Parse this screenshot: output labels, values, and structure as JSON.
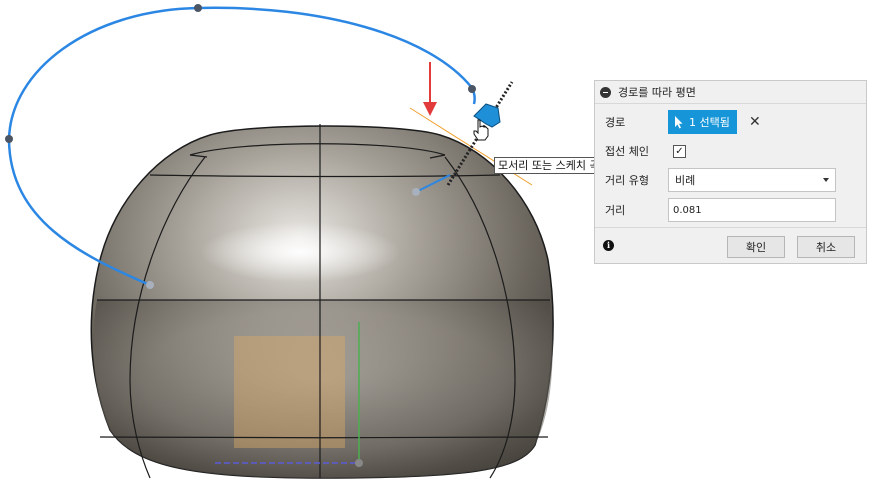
{
  "tooltip": {
    "text": "모서리 또는 스케치 곡선 선택"
  },
  "panel": {
    "title": "경로를 따라 평면",
    "collapse_icon": "minus-circle-icon",
    "path_label": "경로",
    "path_selection": "1 선택됨",
    "clear_symbol": "✕",
    "chain_label": "접선 체인",
    "chain_checked": true,
    "chain_mark": "✓",
    "distance_type_label": "거리 유형",
    "distance_type_value": "비례",
    "distance_label": "거리",
    "distance_value": "0.081",
    "info_symbol": "i",
    "ok_label": "확인",
    "cancel_label": "취소"
  },
  "colors": {
    "path_curve": "#2b87e3",
    "selection_blue": "#1696d8",
    "guide_orange": "#f0a030",
    "arrow_red": "#e23b3b",
    "axis_green": "#4caf50"
  }
}
